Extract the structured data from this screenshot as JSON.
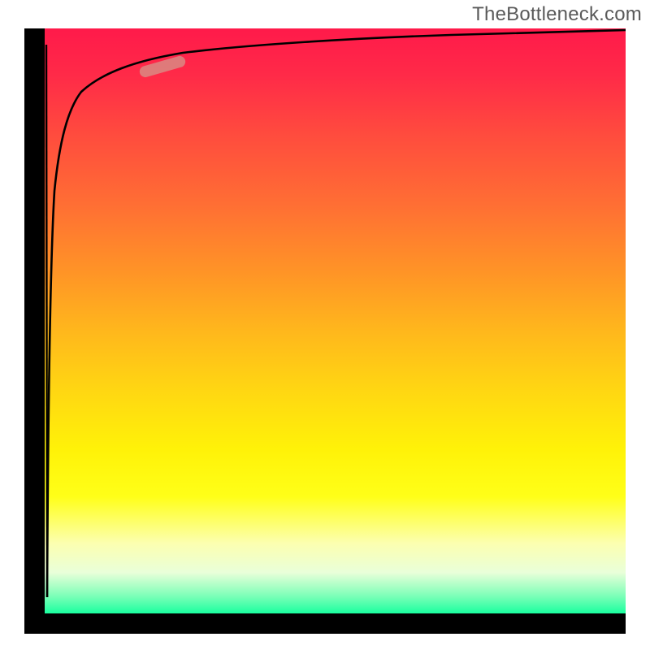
{
  "watermark": "TheBottleneck.com",
  "colors": {
    "axis": "#000000",
    "curve": "#000000",
    "highlight": "#d98a84",
    "gradient_top": "#ff1a4a",
    "gradient_mid": "#ffd712",
    "gradient_bottom": "#1aff9f",
    "watermark_text": "#5a5a5a"
  },
  "chart_data": {
    "type": "line",
    "title": "",
    "xlabel": "",
    "ylabel": "",
    "xlim": [
      0,
      100
    ],
    "ylim": [
      0,
      100
    ],
    "grid": false,
    "legend_position": "none",
    "background": "vertical-gradient red→yellow→green (bottleneck severity heatmap)",
    "series": [
      {
        "name": "bottleneck-curve",
        "x": [
          0,
          0.3,
          0.5,
          1,
          1.5,
          2,
          3,
          4,
          6,
          8,
          10,
          15,
          20,
          25,
          30,
          40,
          50,
          60,
          70,
          80,
          90,
          100
        ],
        "values": [
          97,
          3,
          30,
          60,
          72,
          78,
          84,
          87,
          90,
          92,
          93,
          95,
          96,
          96.5,
          97,
          97.8,
          98.3,
          98.6,
          98.9,
          99.1,
          99.3,
          99.5
        ]
      }
    ],
    "annotations": [
      {
        "name": "highlight-segment",
        "kind": "range-marker",
        "x_range": [
          16,
          24
        ],
        "y_range": [
          93,
          96
        ],
        "color": "#d98a84"
      }
    ]
  }
}
